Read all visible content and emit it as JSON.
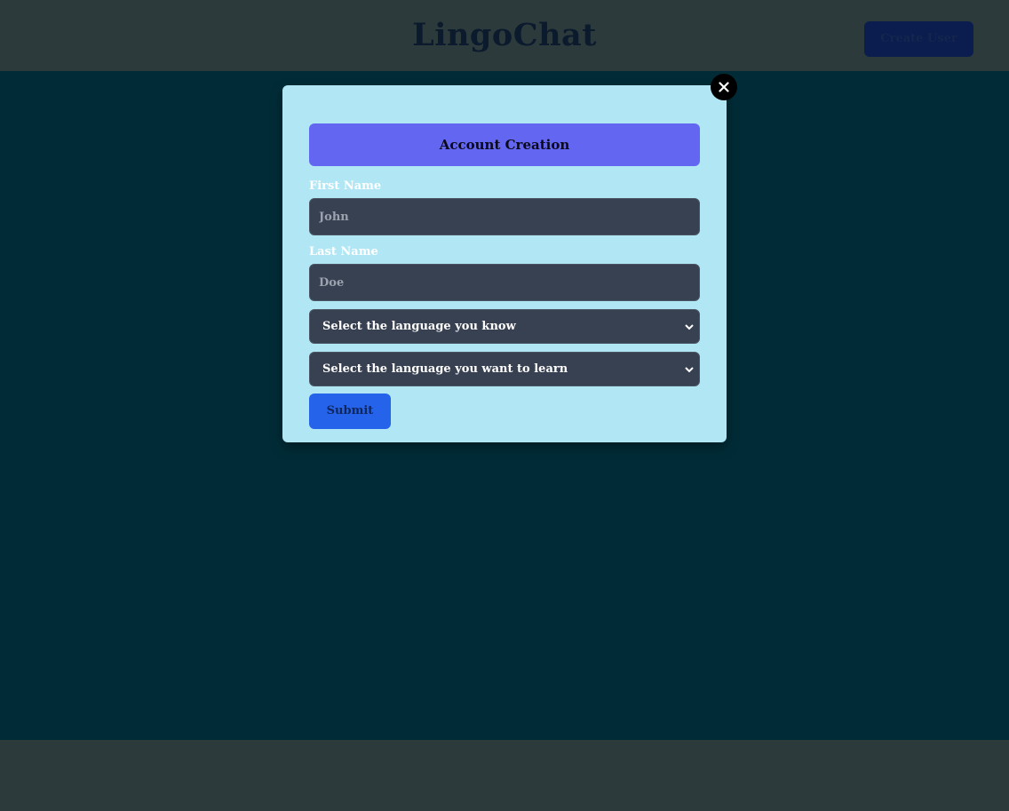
{
  "header": {
    "title": "LingoChat",
    "create_user_label": "Create User"
  },
  "modal": {
    "close_icon": "close-icon",
    "heading": "Account Creation",
    "first_name": {
      "label": "First Name",
      "placeholder": "John",
      "value": ""
    },
    "last_name": {
      "label": "Last Name",
      "placeholder": "Doe",
      "value": ""
    },
    "known_language_select": {
      "selected": "Select the language you know"
    },
    "learn_language_select": {
      "selected": "Select the language you want to learn"
    },
    "submit_label": "Submit"
  },
  "colors": {
    "header_bg": "#2d3a3c",
    "main_bg": "#012c37",
    "modal_bg": "#b1e7f4",
    "heading_bg": "#6366f1",
    "input_bg": "#374151",
    "submit_bg": "#2563eb",
    "create_user_bg": "#0b1d4e"
  }
}
